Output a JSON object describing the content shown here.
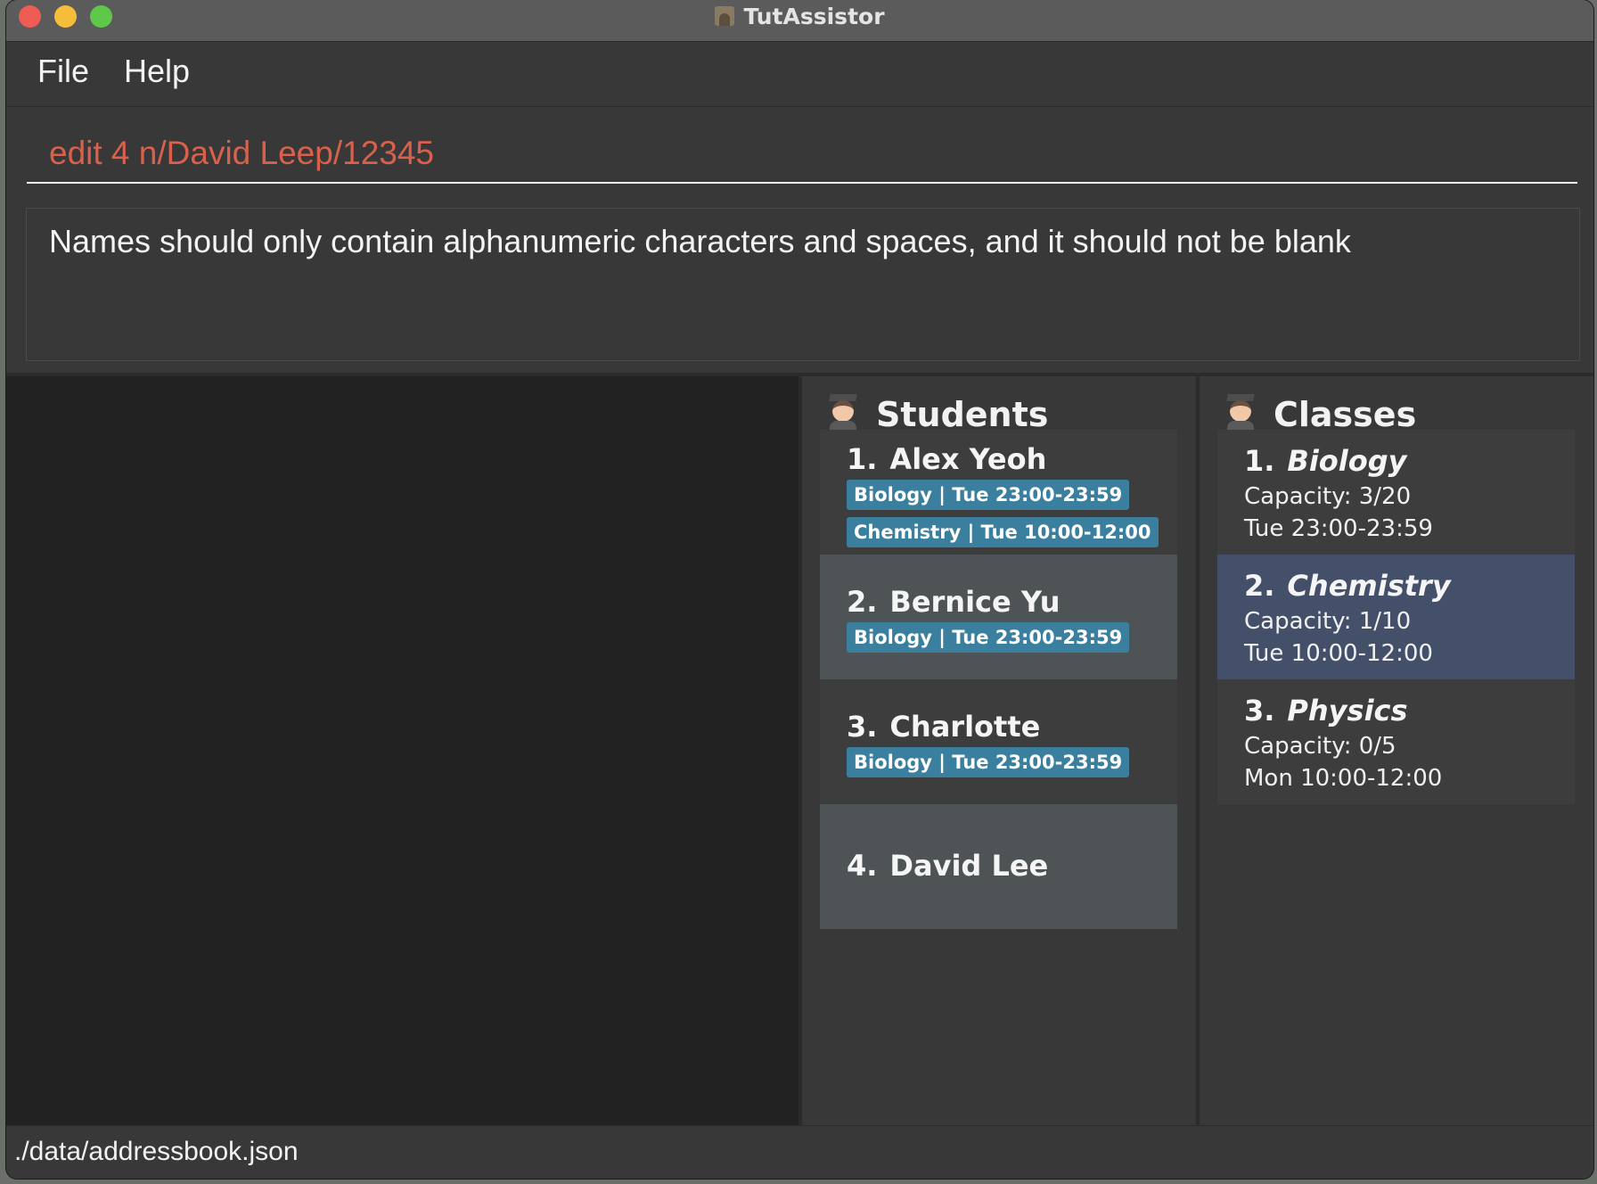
{
  "window": {
    "title": "TutAssistor"
  },
  "menu": {
    "file": "File",
    "help": "Help"
  },
  "command": {
    "value": "edit 4 n/David Leep/12345"
  },
  "result": {
    "message": "Names should only contain alphanumeric characters and spaces, and it should not be blank"
  },
  "students": {
    "title": "Students",
    "items": [
      {
        "index": "1.",
        "name": "Alex Yeoh",
        "tags": [
          "Biology | Tue 23:00-23:59",
          "Chemistry | Tue 10:00-12:00"
        ]
      },
      {
        "index": "2.",
        "name": "Bernice Yu",
        "tags": [
          "Biology | Tue 23:00-23:59"
        ]
      },
      {
        "index": "3.",
        "name": "Charlotte",
        "tags": [
          "Biology | Tue 23:00-23:59"
        ]
      },
      {
        "index": "4.",
        "name": "David Lee",
        "tags": []
      }
    ]
  },
  "classes": {
    "title": "Classes",
    "items": [
      {
        "index": "1.",
        "name": "Biology",
        "capacity": "Capacity: 3/20",
        "time": "Tue 23:00-23:59"
      },
      {
        "index": "2.",
        "name": "Chemistry",
        "capacity": "Capacity: 1/10",
        "time": "Tue 10:00-12:00"
      },
      {
        "index": "3.",
        "name": "Physics",
        "capacity": "Capacity: 0/5",
        "time": "Mon 10:00-12:00"
      }
    ]
  },
  "status": {
    "path": "./data/addressbook.json"
  },
  "colors": {
    "command_text": "#d9614c",
    "tag_bg": "#3b7f9e",
    "selected_class_bg": "#44506a"
  }
}
